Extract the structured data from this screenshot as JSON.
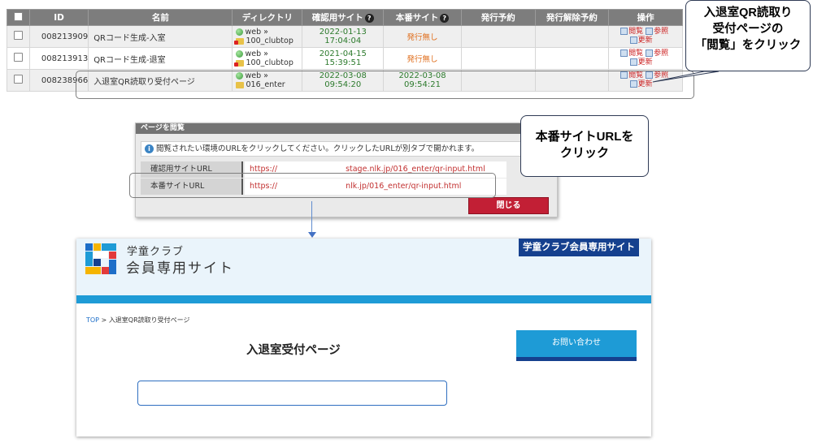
{
  "table": {
    "headers": [
      "ID",
      "名前",
      "ディレクトリ",
      "確認用サイト",
      "本番サイト",
      "発行予約",
      "発行解除予約",
      "操作"
    ],
    "rows": [
      {
        "id": "008213909",
        "name": "QRコード生成-入室",
        "dir_top": "web »",
        "dir_bottom": "100_clubtop",
        "staging": "2022-01-13 17:04:04",
        "production": "発行無し",
        "op_view": "閲覧",
        "op_ref": "参照",
        "op_update": "更新"
      },
      {
        "id": "008213913",
        "name": "QRコード生成-退室",
        "dir_top": "web »",
        "dir_bottom": "100_clubtop",
        "staging": "2021-04-15 15:39:51",
        "production": "発行無し",
        "op_view": "閲覧",
        "op_ref": "参照",
        "op_update": "更新"
      },
      {
        "id": "008238966",
        "name": "入退室QR読取り受付ページ",
        "dir_top": "web »",
        "dir_bottom": "016_enter",
        "staging": "2022-03-08 09:54:20",
        "production": "2022-03-08 09:54:21",
        "op_view": "閲覧",
        "op_ref": "参照",
        "op_update": "更新"
      }
    ]
  },
  "callout1": {
    "line1": "入退室QR読取り",
    "line2": "受付ページの",
    "line3": "「閲覧」をクリック"
  },
  "callout2": {
    "line1": "本番サイトURLを",
    "line2": "クリック"
  },
  "modal": {
    "title": "ページを閲覧",
    "info": "閲覧されたい環境のURLをクリックしてください。クリックしたURLが別タブで開かれます。",
    "staging_label": "確認用サイトURL",
    "staging_url_a": "https://",
    "staging_url_b": "stage.nlk.jp/016_enter/qr-input.html",
    "prod_label": "本番サイトURL",
    "prod_url_a": "https://",
    "prod_url_b": "nlk.jp/016_enter/qr-input.html",
    "close": "閉じる"
  },
  "site": {
    "club": "学童クラブ",
    "member": "会員専用サイト",
    "badge": "学童クラブ会員専用サイト",
    "crumb_top": "TOP",
    "crumb_sep": " > ",
    "crumb_page": "入退室QR読取り受付ページ",
    "title": "入退室受付ページ",
    "contact": "お問い合わせ"
  }
}
